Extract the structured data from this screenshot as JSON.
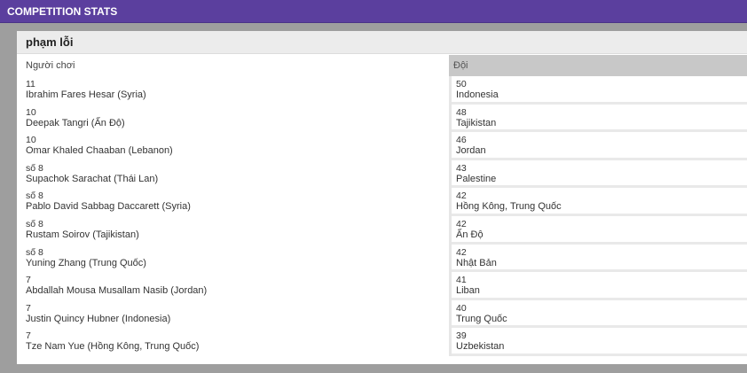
{
  "topbar": {
    "title": "COMPETITION STATS"
  },
  "panel": {
    "title": "phạm lỗi",
    "columns": {
      "player": "Người chơi",
      "team": "Đội"
    },
    "players": [
      {
        "value": "11",
        "name": "Ibrahim Fares Hesar (Syria)"
      },
      {
        "value": "10",
        "name": "Deepak Tangri (Ấn Độ)"
      },
      {
        "value": "10",
        "name": "Omar Khaled Chaaban (Lebanon)"
      },
      {
        "value": "số 8",
        "name": "Supachok Sarachat (Thái Lan)"
      },
      {
        "value": "số 8",
        "name": "Pablo David Sabbag Daccarett (Syria)"
      },
      {
        "value": "số 8",
        "name": "Rustam Soirov (Tajikistan)"
      },
      {
        "value": "số 8",
        "name": "Yuning Zhang (Trung Quốc)"
      },
      {
        "value": "7",
        "name": "Abdallah Mousa Musallam Nasib (Jordan)"
      },
      {
        "value": "7",
        "name": "Justin Quincy Hubner (Indonesia)"
      },
      {
        "value": "7",
        "name": "Tze Nam Yue (Hồng Kông, Trung Quốc)"
      }
    ],
    "teams": [
      {
        "value": "50",
        "name": "Indonesia"
      },
      {
        "value": "48",
        "name": "Tajikistan"
      },
      {
        "value": "46",
        "name": "Jordan"
      },
      {
        "value": "43",
        "name": "Palestine"
      },
      {
        "value": "42",
        "name": "Hồng Kông, Trung Quốc"
      },
      {
        "value": "42",
        "name": "Ấn Độ"
      },
      {
        "value": "42",
        "name": "Nhật Bản"
      },
      {
        "value": "41",
        "name": "Liban"
      },
      {
        "value": "40",
        "name": "Trung Quốc"
      },
      {
        "value": "39",
        "name": "Uzbekistan"
      }
    ]
  }
}
